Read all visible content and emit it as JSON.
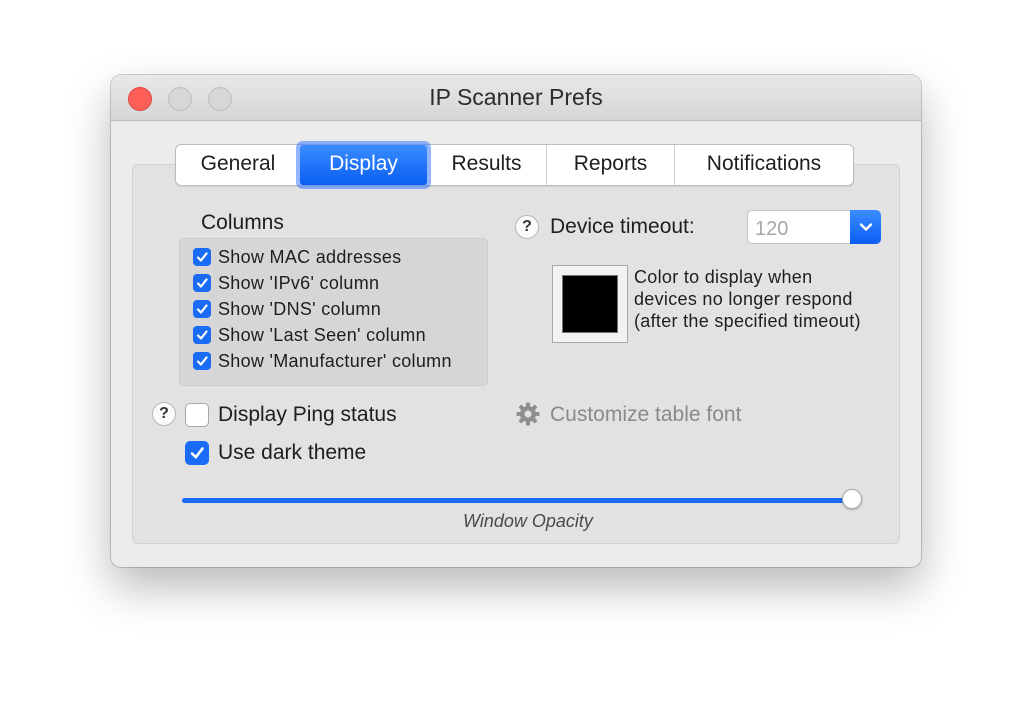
{
  "window": {
    "title": "IP Scanner Prefs"
  },
  "tabs": [
    {
      "label": "General",
      "active": false
    },
    {
      "label": "Display",
      "active": true
    },
    {
      "label": "Results",
      "active": false
    },
    {
      "label": "Reports",
      "active": false
    },
    {
      "label": "Notifications",
      "active": false
    }
  ],
  "columns": {
    "heading": "Columns",
    "items": [
      {
        "label": "Show MAC addresses",
        "checked": true
      },
      {
        "label": "Show 'IPv6' column",
        "checked": true
      },
      {
        "label": "Show 'DNS' column",
        "checked": true
      },
      {
        "label": "Show 'Last Seen' column",
        "checked": true
      },
      {
        "label": "Show 'Manufacturer' column",
        "checked": true
      }
    ]
  },
  "ping_status": {
    "label": "Display Ping status",
    "checked": false,
    "help": "?"
  },
  "dark_theme": {
    "label": "Use dark theme",
    "checked": true
  },
  "timeout": {
    "help": "?",
    "label": "Device timeout:",
    "value": "120"
  },
  "color": {
    "swatch_color": "#000000",
    "desc_line1": "Color to display when",
    "desc_line2": "devices no longer respond",
    "desc_line3": "(after the specified timeout)"
  },
  "table_font": {
    "label": "Customize table font",
    "icon": "gear-icon"
  },
  "opacity": {
    "label": "Window Opacity",
    "value": 1.0
  },
  "colors": {
    "accent": "#1a6bf5",
    "close": "#fd5e57"
  }
}
